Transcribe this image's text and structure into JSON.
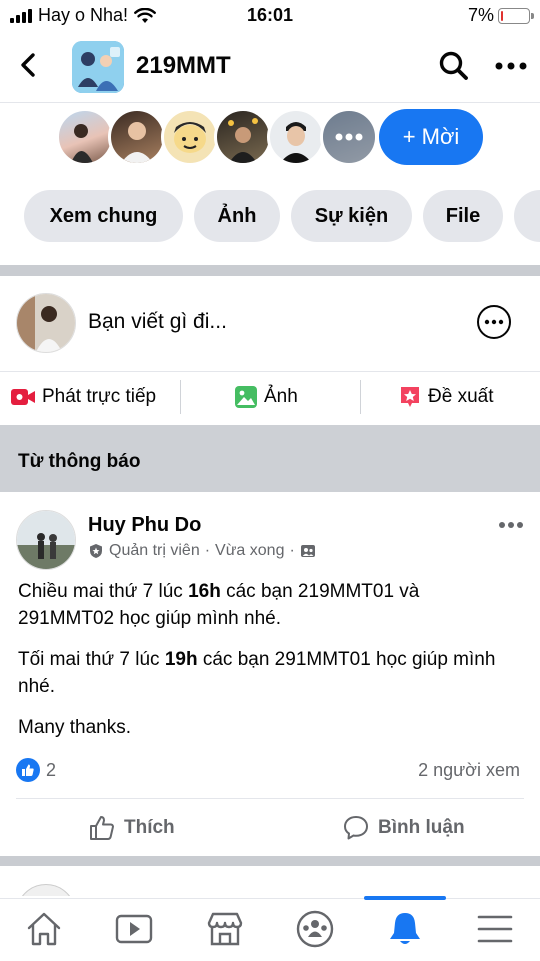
{
  "status_bar": {
    "carrier": "Hay o Nha!",
    "time": "16:01",
    "battery": "7%",
    "battery_level": 0.07
  },
  "header": {
    "group_name": "219MMT"
  },
  "members": {
    "invite_label": "+ Mời"
  },
  "tabs": [
    {
      "label": "Xem chung"
    },
    {
      "label": "Ảnh"
    },
    {
      "label": "Sự kiện"
    },
    {
      "label": "File"
    }
  ],
  "composer": {
    "prompt": "Bạn viết gì đi..."
  },
  "actions": {
    "live": "Phát trực tiếp",
    "photo": "Ảnh",
    "suggest": "Đề xuất"
  },
  "section": {
    "title": "Từ thông báo"
  },
  "post": {
    "author": "Huy Phu Do",
    "role": "Quản trị viên",
    "time": "Vừa xong",
    "para1_a": "Chiều mai thứ 7 lúc ",
    "para1_b": "16h",
    "para1_c": " các bạn 219MMT01 và 291MMT02 học giúp mình nhé.",
    "para2_a": "Tối mai thứ 7  lúc ",
    "para2_b": "19h",
    "para2_c": " các bạn 291MMT01 học giúp mình nhé.",
    "para3": "Many thanks.",
    "like_count": "2",
    "views": "2 người xem",
    "like_label": "Thích",
    "comment_label": "Bình luận"
  },
  "colors": {
    "accent": "#1877f2",
    "section_bg": "#cdd0d5",
    "live_red": "#e41e3f",
    "photo_green": "#45bd62",
    "suggest_red": "#f3425f"
  }
}
